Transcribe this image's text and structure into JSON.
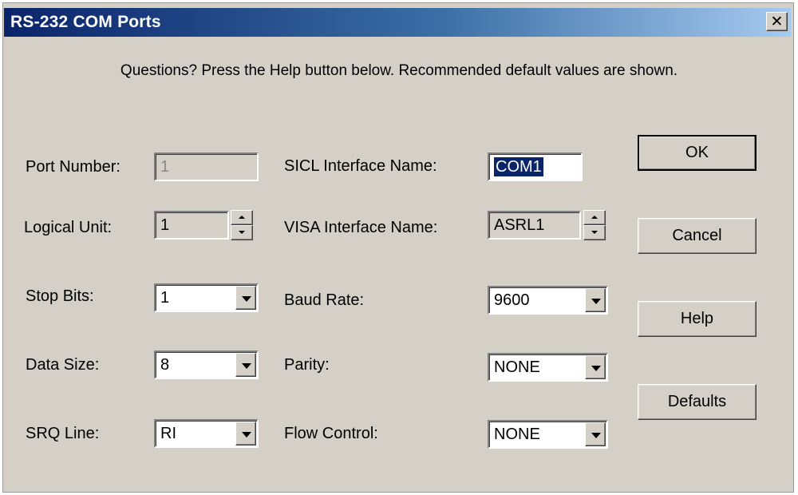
{
  "window": {
    "title": "RS-232 COM Ports",
    "close_glyph": "✕"
  },
  "info_text": "Questions?  Press the Help button below.  Recommended default values are shown.",
  "left": {
    "port_number": {
      "label": "Port Number:",
      "value": "1"
    },
    "logical_unit": {
      "label": "Logical Unit:",
      "value": "1"
    },
    "stop_bits": {
      "label": "Stop Bits:",
      "value": "1"
    },
    "data_size": {
      "label": "Data Size:",
      "value": "8"
    },
    "srq_line": {
      "label": "SRQ Line:",
      "value": "RI"
    }
  },
  "right": {
    "sicl_name": {
      "label": "SICL Interface Name:",
      "value": "COM1"
    },
    "visa_name": {
      "label": "VISA Interface Name:",
      "value": "ASRL1"
    },
    "baud_rate": {
      "label": "Baud Rate:",
      "value": "9600"
    },
    "parity": {
      "label": "Parity:",
      "value": "NONE"
    },
    "flow_control": {
      "label": "Flow Control:",
      "value": "NONE"
    }
  },
  "buttons": {
    "ok": "OK",
    "cancel": "Cancel",
    "help": "Help",
    "defaults": "Defaults"
  },
  "colors": {
    "titlebar_start": "#0a246a",
    "titlebar_end": "#a6caf0",
    "face": "#d4d0c8"
  }
}
